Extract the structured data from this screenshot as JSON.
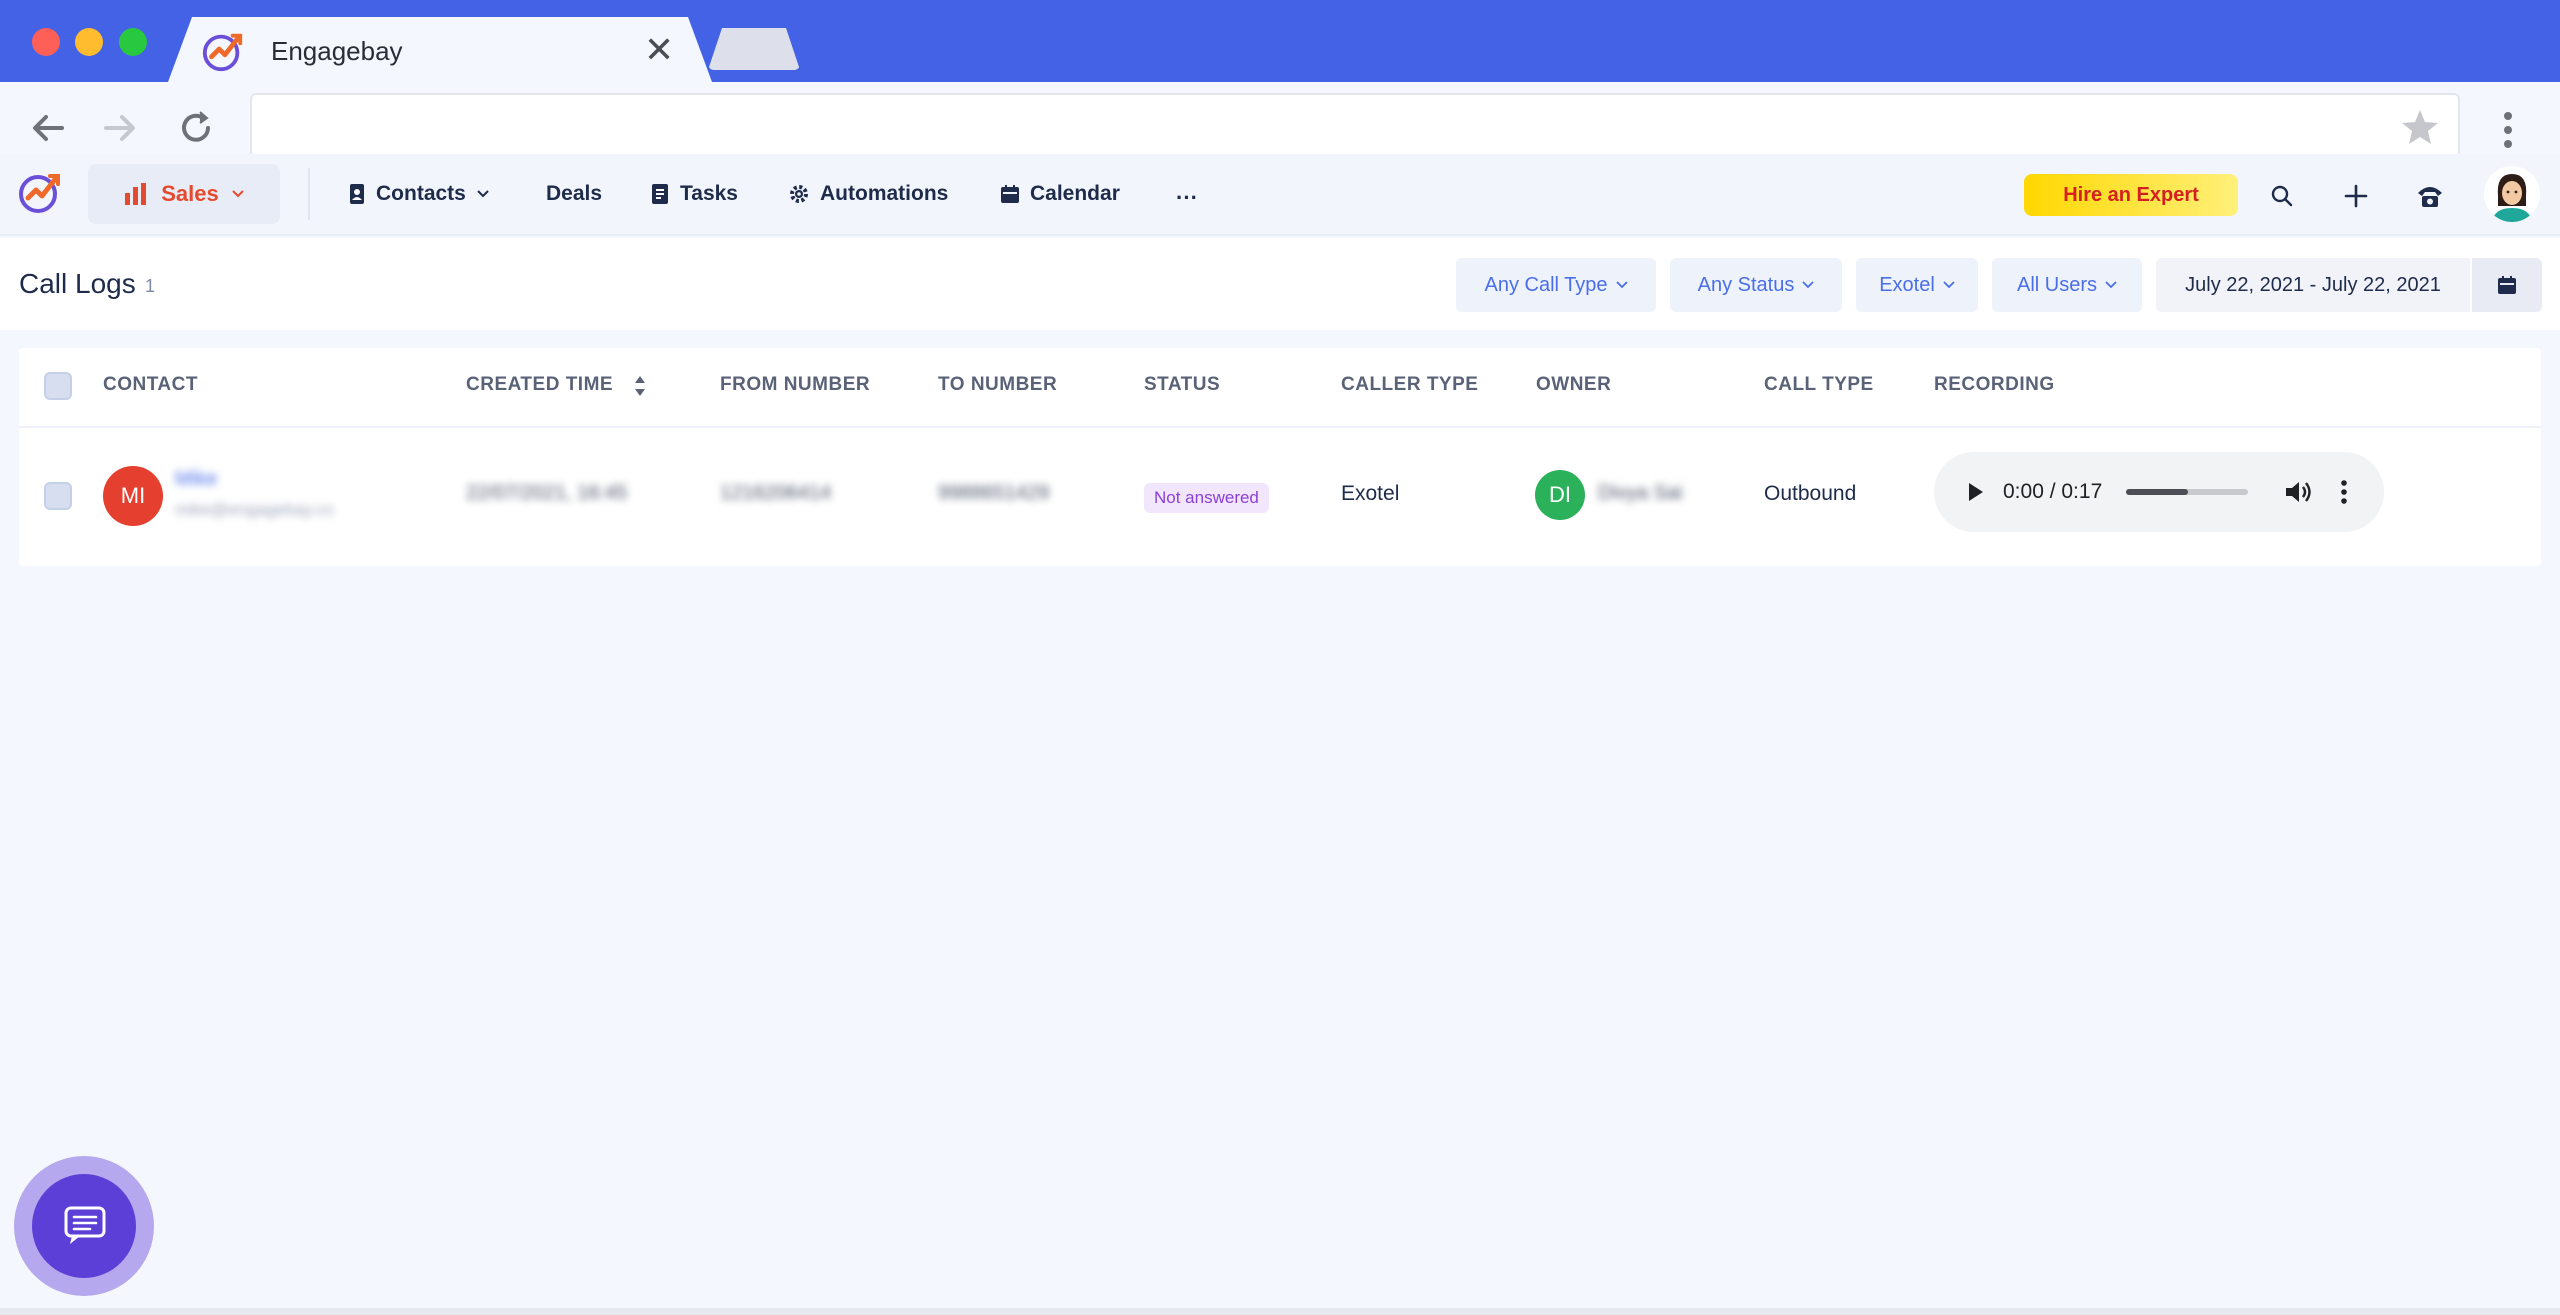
{
  "browser": {
    "tab_title": "Engagebay",
    "close_glyph": "✕"
  },
  "header": {
    "module_label": "Sales",
    "nav": [
      {
        "label": "Contacts",
        "icon": "contacts-book-icon"
      },
      {
        "label": "Deals"
      },
      {
        "label": "Tasks",
        "icon": "tasks-icon"
      },
      {
        "label": "Automations",
        "icon": "gear-icon"
      },
      {
        "label": "Calendar",
        "icon": "calendar-icon"
      }
    ],
    "more_glyph": "···",
    "hire_label": "Hire an Expert",
    "accent_color": "#e64a2e"
  },
  "page": {
    "title": "Call Logs",
    "count": "1",
    "filters": {
      "call_type": "Any Call Type",
      "status": "Any Status",
      "provider": "Exotel",
      "users": "All Users"
    },
    "date_range": "July 22, 2021 - July 22, 2021"
  },
  "table": {
    "columns": [
      "CONTACT",
      "CREATED TIME",
      "FROM NUMBER",
      "TO NUMBER",
      "STATUS",
      "CALLER TYPE",
      "OWNER",
      "CALL TYPE",
      "RECORDING"
    ],
    "rows": [
      {
        "contact_initials": "MI",
        "contact_name": "Mike",
        "contact_email": "mike@engagebay.co",
        "created_time": "22/07/2021, 16:45",
        "from_number": "1216206414",
        "to_number": "9988651429",
        "status": "Not answered",
        "caller_type": "Exotel",
        "owner_initials": "DI",
        "owner_name": "Divya Sai",
        "call_type": "Outbound",
        "recording": {
          "time": "0:00 / 0:17",
          "volume_level": 0.5
        }
      }
    ]
  },
  "colors": {
    "browser_bar": "#4462e6",
    "filter_text": "#4a6ee8",
    "status_badge": "#8c3fd6",
    "avatar_contact": "#e53f2f",
    "avatar_owner": "#2bb15a",
    "chat_widget": "#5b3fd6"
  }
}
